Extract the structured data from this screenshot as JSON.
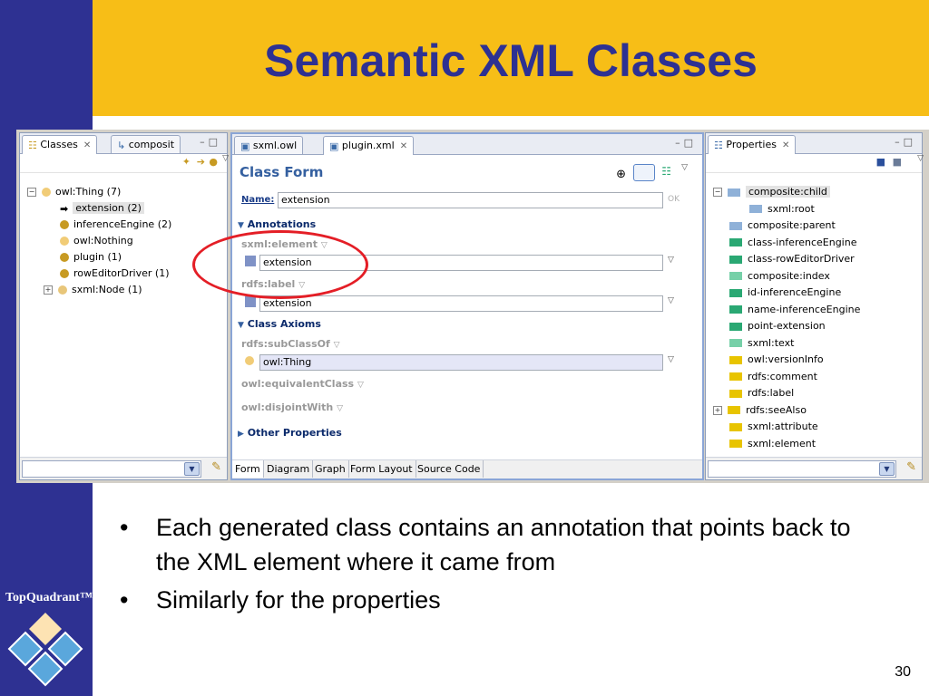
{
  "slide": {
    "title": "Semantic XML Classes",
    "page_number": "30",
    "logo_text": "TopQuadrant™",
    "bullets": [
      "Each generated class contains an annotation that points back to the XML element where it came from",
      "Similarly for the properties"
    ],
    "colors": {
      "sidebar": "#2e3192",
      "header": "#f7be17",
      "title": "#2e3192",
      "highlight": "#e41e26"
    }
  },
  "left_pane": {
    "tabs": [
      {
        "label": "Classes",
        "icon": "class-hierarchy-icon"
      },
      {
        "label": "composit",
        "icon": "hierarchy-icon"
      }
    ],
    "tree": [
      {
        "label": "owl:Thing  (7)",
        "icon": "circle-light",
        "level": 0
      },
      {
        "label": "extension  (2)",
        "icon": "arrow-selected",
        "level": 1,
        "selected": true
      },
      {
        "label": "inferenceEngine  (2)",
        "icon": "circle-gold",
        "level": 1
      },
      {
        "label": "owl:Nothing",
        "icon": "circle-light",
        "level": 1
      },
      {
        "label": "plugin  (1)",
        "icon": "circle-gold",
        "level": 1
      },
      {
        "label": "rowEditorDriver  (1)",
        "icon": "circle-gold",
        "level": 1
      },
      {
        "label": "sxml:Node  (1)",
        "icon": "circle-pale",
        "level": 1
      }
    ]
  },
  "middle_pane": {
    "tabs": [
      {
        "label": "sxml.owl",
        "icon": "file-icon"
      },
      {
        "label": "plugin.xml",
        "icon": "file-icon",
        "active": true
      }
    ],
    "form_title": "Class Form",
    "name_label": "Name:",
    "name_value": "extension",
    "ok_label": "OK",
    "annotations_label": "Annotations",
    "sxml_element_label": "sxml:element",
    "sxml_element_value": "extension",
    "rdfs_label_label": "rdfs:label",
    "rdfs_label_value": "extension",
    "class_axioms_label": "Class Axioms",
    "subclassof_label": "rdfs:subClassOf",
    "subclassof_value": "owl:Thing",
    "equivalent_label": "owl:equivalentClass",
    "disjoint_label": "owl:disjointWith",
    "other_properties_label": "Other Properties",
    "bottom_tabs": [
      "Form",
      "Diagram",
      "Graph",
      "Form Layout",
      "Source Code"
    ]
  },
  "right_pane": {
    "tabs": [
      {
        "label": "Properties",
        "icon": "properties-icon"
      }
    ],
    "tree": [
      {
        "label": "composite:child",
        "color": "#8fb1d8",
        "expander": "-",
        "selected": true
      },
      {
        "label": "sxml:root",
        "color": "#8fb1d8",
        "child": true
      },
      {
        "label": "composite:parent",
        "color": "#8fb1d8"
      },
      {
        "label": "class-inferenceEngine",
        "color": "#2aa873"
      },
      {
        "label": "class-rowEditorDriver",
        "color": "#2aa873"
      },
      {
        "label": "composite:index",
        "color": "#76d0a8"
      },
      {
        "label": "id-inferenceEngine",
        "color": "#2aa873"
      },
      {
        "label": "name-inferenceEngine",
        "color": "#2aa873"
      },
      {
        "label": "point-extension",
        "color": "#2aa873"
      },
      {
        "label": "sxml:text",
        "color": "#76d0a8"
      },
      {
        "label": "owl:versionInfo",
        "color": "#e8c400"
      },
      {
        "label": "rdfs:comment",
        "color": "#e8c400"
      },
      {
        "label": "rdfs:label",
        "color": "#e8c400"
      },
      {
        "label": "rdfs:seeAlso",
        "color": "#e8c400",
        "expander": "+"
      },
      {
        "label": "sxml:attribute",
        "color": "#e8c400"
      },
      {
        "label": "sxml:element",
        "color": "#e8c400"
      }
    ]
  }
}
